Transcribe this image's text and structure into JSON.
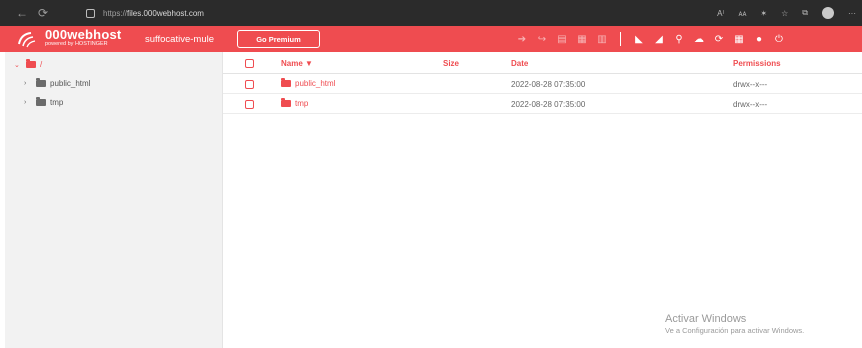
{
  "browser": {
    "url_protocol": "https://",
    "url_host": "files.000webhost.com",
    "nav_icons": [
      "back-icon",
      "reload-icon"
    ],
    "right_icons": [
      "read-aloud-icon",
      "translate-icon",
      "extensions-icon",
      "favorites-icon",
      "collections-icon",
      "profile-icon",
      "more-icon"
    ],
    "right_glyphs": [
      "A⁾",
      "ᴀᴀ",
      "✶",
      "☆",
      "⧉",
      "",
      "···"
    ]
  },
  "app": {
    "brand_name": "000webhost",
    "brand_sub": "powered by HOSTINGER",
    "site_name": "suffocative-mule",
    "premium_label": "Go Premium",
    "accent": "#ef4c50"
  },
  "toolbar": {
    "group1": [
      {
        "name": "move-icon",
        "glyph": "➔"
      },
      {
        "name": "rename-icon",
        "glyph": "↪"
      },
      {
        "name": "download-icon",
        "glyph": "▤"
      },
      {
        "name": "archive-icon",
        "glyph": "▦"
      },
      {
        "name": "delete-icon",
        "glyph": "▥"
      }
    ],
    "group2": [
      {
        "name": "new-file-icon",
        "glyph": "◣"
      },
      {
        "name": "new-folder-icon",
        "glyph": "◢"
      },
      {
        "name": "search-icon",
        "glyph": "⚲"
      },
      {
        "name": "upload-icon",
        "glyph": "☁"
      },
      {
        "name": "refresh-icon",
        "glyph": "⟳"
      },
      {
        "name": "grid-view-icon",
        "glyph": "▦"
      },
      {
        "name": "help-icon",
        "glyph": "●"
      },
      {
        "name": "power-icon",
        "glyph": "⏻"
      }
    ]
  },
  "sidebar": {
    "root_label": "/",
    "items": [
      {
        "label": "public_html"
      },
      {
        "label": "tmp"
      }
    ]
  },
  "table": {
    "headers": {
      "name": "Name ▼",
      "size": "Size",
      "date": "Date",
      "permissions": "Permissions"
    },
    "rows": [
      {
        "name": "public_html",
        "size": "",
        "date": "2022-08-28 07:35:00",
        "permissions": "drwx--x---"
      },
      {
        "name": "tmp",
        "size": "",
        "date": "2022-08-28 07:35:00",
        "permissions": "drwx--x---"
      }
    ]
  },
  "watermark": {
    "line1": "Activar Windows",
    "line2": "Ve a Configuración para activar Windows."
  }
}
